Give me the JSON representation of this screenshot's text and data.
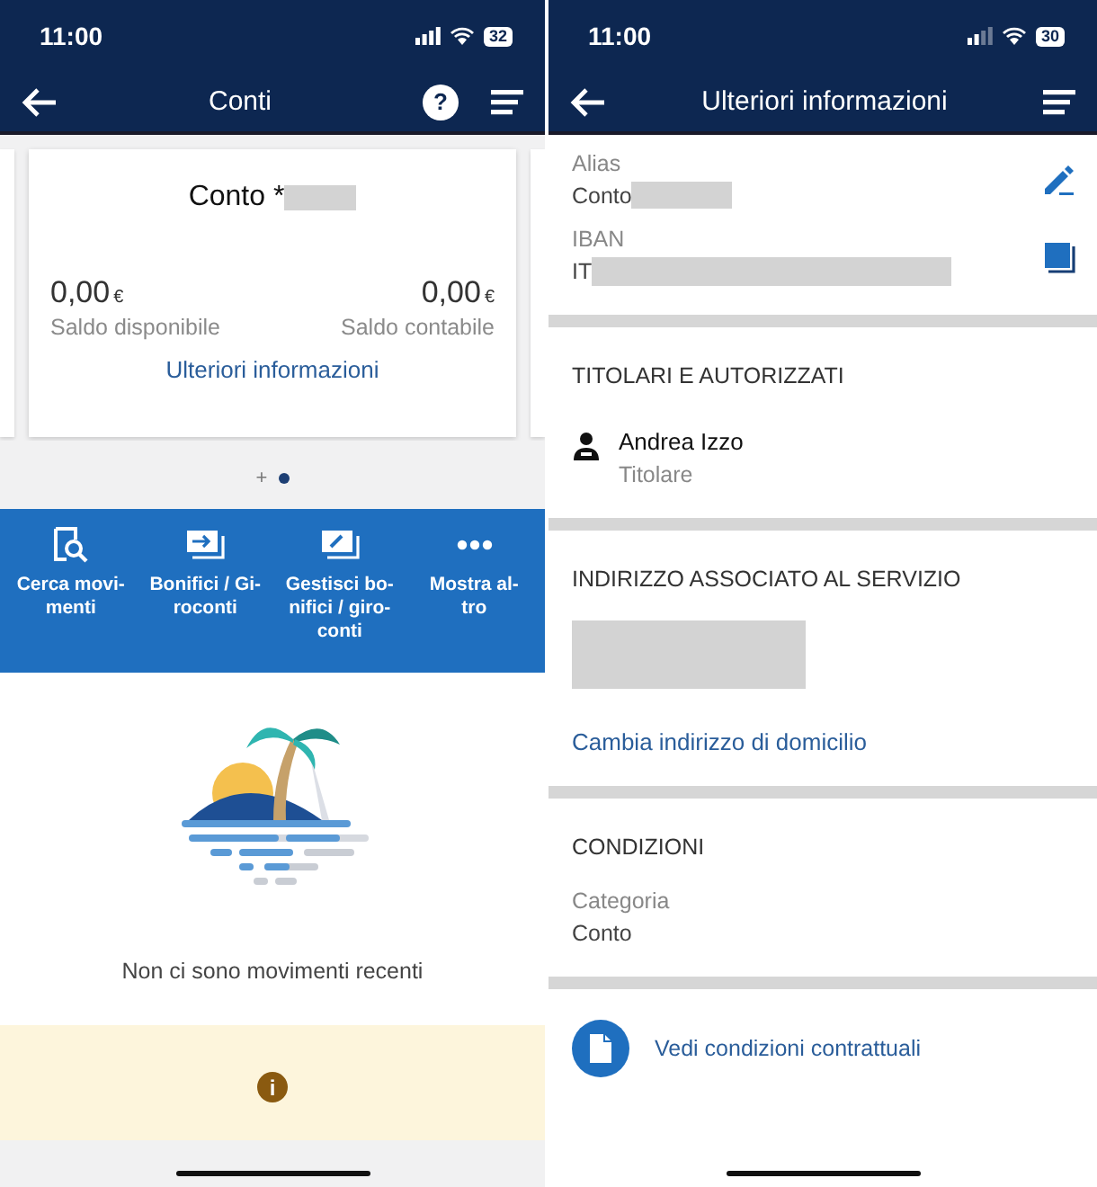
{
  "left": {
    "status_bar": {
      "time": "11:00",
      "battery": "32"
    },
    "header": {
      "title": "Conti",
      "help_glyph": "?"
    },
    "account_card": {
      "title": "Conto *",
      "balances": [
        {
          "amount": "0,00",
          "currency": "€",
          "label": "Saldo disponibile"
        },
        {
          "amount": "0,00",
          "currency": "€",
          "label": "Saldo contabile"
        }
      ],
      "link": "Ulteriori informazioni"
    },
    "pager": {
      "add_glyph": "+",
      "dots": [
        {
          "selected": true
        }
      ]
    },
    "actions": [
      {
        "kind": "search",
        "label": "Cerca movi-\nmenti"
      },
      {
        "kind": "transfer",
        "label": "Bonifici / Gi-\nroconti"
      },
      {
        "kind": "manage",
        "label": "Gestisci bo-\nnifici / giro-\nconti"
      },
      {
        "kind": "more",
        "label": "Mostra al-\ntro"
      }
    ],
    "empty_state": {
      "message": "Non ci sono movimenti recenti"
    },
    "info_banner": {
      "icon_glyph": "i"
    }
  },
  "right": {
    "status_bar": {
      "time": "11:00",
      "battery": "30"
    },
    "header": {
      "title": "Ulteriori informazioni"
    },
    "fields": [
      {
        "label": "Alias",
        "value": "Conto",
        "kind": "edit"
      },
      {
        "label": "IBAN",
        "value": "IT",
        "kind": "copy"
      }
    ],
    "holders": {
      "heading": "TITOLARI E AUTORIZZATI",
      "name": "Andrea Izzo",
      "role": "Titolare"
    },
    "address": {
      "heading": "INDIRIZZO ASSOCIATO AL SERVIZIO",
      "link": "Cambia indirizzo di domicilio"
    },
    "conditions": {
      "heading": "CONDIZIONI",
      "label": "Categoria",
      "value": "Conto"
    },
    "document_link": "Vedi condizioni contrattuali"
  }
}
